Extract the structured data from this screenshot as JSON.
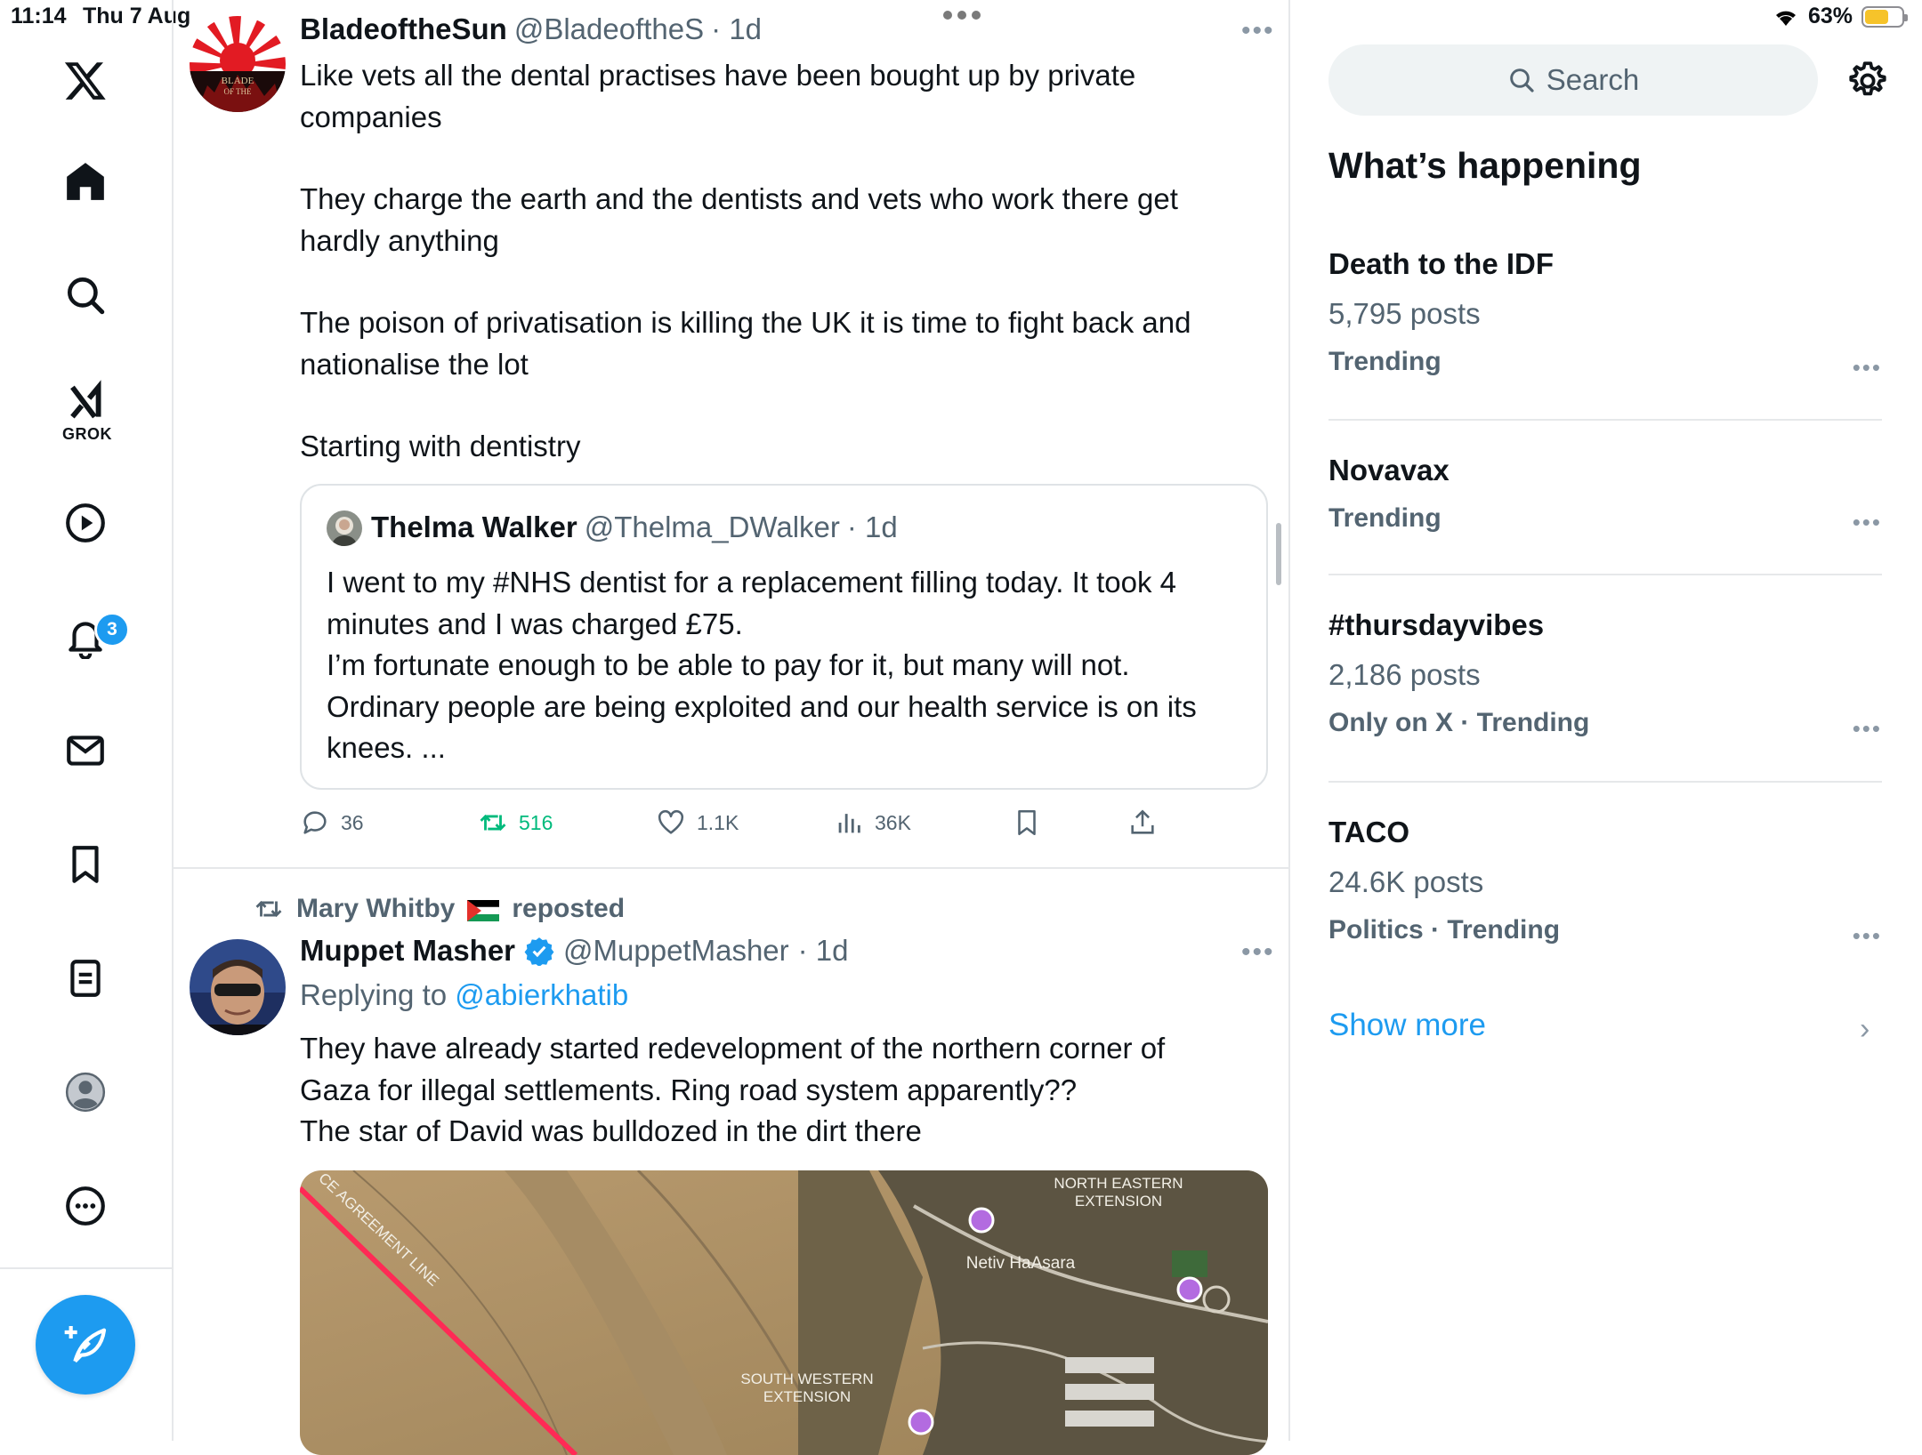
{
  "status": {
    "time": "11:14",
    "date": "Thu 7 Aug",
    "battery": "63%"
  },
  "nav": {
    "grok_label": "GROK",
    "notification_count": "3",
    "icons": [
      "x-logo-icon",
      "home-icon",
      "search-icon",
      "grok-icon",
      "video-icon",
      "notifications-icon",
      "messages-icon",
      "bookmarks-icon",
      "lists-icon",
      "profile-icon",
      "more-icon",
      "compose-icon"
    ]
  },
  "tweet1": {
    "name": "BladeoftheSun",
    "handle": "@BladeoftheS",
    "time": "· 1d",
    "p1_l1": "Like vets all the dental practises have been bought up by private",
    "p1_l2": "companies",
    "p2_l1": "They charge the earth and the dentists and vets who work there get",
    "p2_l2": "hardly anything",
    "p3_l1": "The poison of privatisation is killing the UK it is time to fight back and",
    "p3_l2": "nationalise the lot",
    "p4": "Starting with dentistry",
    "quote": {
      "name": "Thelma Walker",
      "handle": "@Thelma_DWalker",
      "time": "· 1d",
      "l1": "I went to my #NHS dentist for a replacement filling today. It took 4",
      "l2": "minutes and I was charged £75.",
      "l3": "I’m fortunate enough to be able to pay for it, but many will not.",
      "l4": "Ordinary people are being exploited and our health service is on its",
      "l5": "knees. ..."
    },
    "replies": "36",
    "reposts": "516",
    "likes": "1.1K",
    "views": "36K"
  },
  "tweet2": {
    "reposted_by": "Mary Whitby",
    "reposted_label": "reposted",
    "name": "Muppet Masher",
    "handle": "@MuppetMasher",
    "time": "· 1d",
    "replying_label": "Replying to",
    "replying_to": "@abierkhatib",
    "l1": "They have already started redevelopment of the northern corner of",
    "l2": "Gaza for illegal settlements. Ring road system apparently??",
    "l3": "The star of David was bulldozed in the dirt there",
    "map_labels": {
      "ne": "NORTH EASTERN",
      "ne2": "EXTENSION",
      "netiv": "Netiv HaAsara",
      "sw": "SOUTH WESTERN",
      "sw2": "EXTENSION",
      "line": "CE AGREEMENT LINE"
    }
  },
  "sidebar": {
    "search_placeholder": "Search",
    "heading": "What’s happening",
    "trends": [
      {
        "title": "Death to the IDF",
        "posts": "5,795 posts",
        "meta": "Trending"
      },
      {
        "title": "Novavax",
        "meta": "Trending"
      },
      {
        "title": "#thursdayvibes",
        "posts": "2,186 posts",
        "meta": "Only on X · Trending"
      },
      {
        "title": "TACO",
        "posts": "24.6K posts",
        "meta": "Politics · Trending"
      }
    ],
    "show_more": "Show more"
  },
  "colors": {
    "accent": "#1d9bf0",
    "repost_green": "#00ba7c",
    "muted": "#536471"
  }
}
